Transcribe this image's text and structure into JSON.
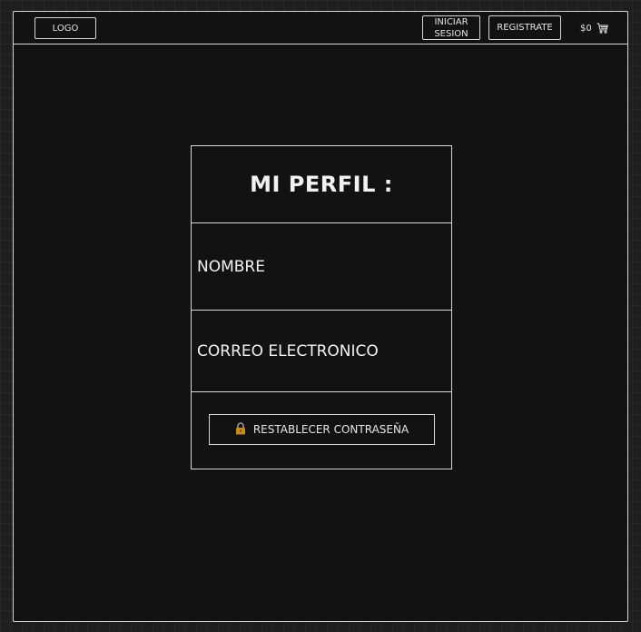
{
  "navbar": {
    "logo_label": "LOGO",
    "login_label": "INICIAR SESION",
    "register_label": "REGISTRATE",
    "cart_total": "$0",
    "cart_icon": "shopping-cart-icon"
  },
  "profile": {
    "title": "MI PERFIL :",
    "name_label": "NOMBRE",
    "email_label": "CORREO ELECTRONICO",
    "reset_password_label": "RESTABLECER CONTRASEÑA",
    "reset_icon": "lock-icon"
  },
  "colors": {
    "background": "#121212",
    "stroke": "#d8d8d8",
    "text": "#f2f2f2",
    "lock_body": "#c98a1a"
  }
}
